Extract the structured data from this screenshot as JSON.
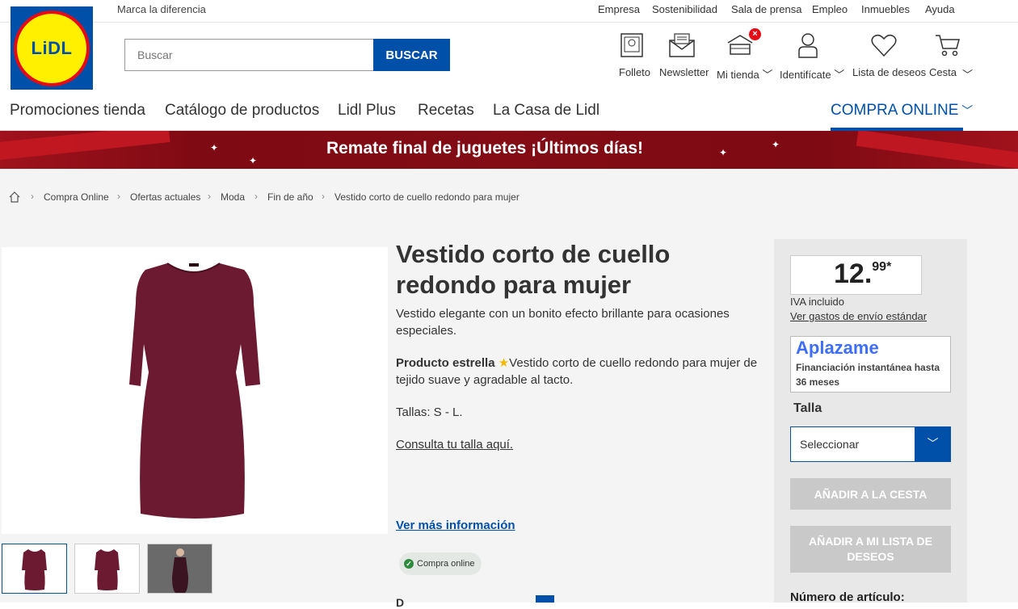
{
  "top_bar": {
    "tagline": "Marca la diferencia",
    "links": [
      "Empresa",
      "Sostenibilidad",
      "Sala de prensa",
      "Empleo",
      "Inmuebles",
      "Ayuda"
    ]
  },
  "logo": {
    "text": "LiDL"
  },
  "search": {
    "placeholder": "Buscar",
    "button": "BUSCAR"
  },
  "header_icons": {
    "folleto": "Folleto",
    "newsletter": "Newsletter",
    "mi_tienda": "Mi tienda",
    "identificate": "Identifícate",
    "lista_deseos": "Lista de deseos",
    "cesta": "Cesta"
  },
  "main_nav": [
    "Promociones tienda",
    "Catálogo de productos",
    "Lidl Plus",
    "Recetas",
    "La Casa de Lidl"
  ],
  "compra_online": "COMPRA ONLINE",
  "banner": {
    "text": "Remate final de juguetes ¡Últimos días!"
  },
  "breadcrumb": [
    "Compra Online",
    "Ofertas actuales",
    "Moda",
    "Fin de año",
    "Vestido corto de cuello redondo para mujer"
  ],
  "product": {
    "title": "Vestido corto de cuello redondo para mujer",
    "subtitle": "Vestido elegante con un bonito efecto brillante para ocasiones especiales.",
    "estrella_label": "Producto estrella",
    "estrella_text": "Vestido corto de cuello redondo para mujer de tejido suave y agradable al tacto.",
    "tallas": "Tallas: S - L.",
    "consulta": "Consulta tu talla aquí.",
    "ver_mas": "Ver más información",
    "online_badge": "Compra online",
    "bottom_peek": "D"
  },
  "sidebar": {
    "price_int": "12.",
    "price_dec": "99*",
    "iva": "IVA incluido",
    "envio": "Ver gastos de envío estándar",
    "aplazame_logo": "Aplazame",
    "aplazame_text": "Financiación instantánea hasta 36 meses",
    "talla_label": "Talla",
    "select_value": "Seleccionar",
    "add_cart": "AÑADIR A LA CESTA",
    "add_wishlist": "AÑADIR A MI LISTA DE DESEOS",
    "art_num": "Número de artículo:"
  },
  "colors": {
    "brand_blue": "#0050aa",
    "brand_red": "#e60a14",
    "brand_yellow": "#fff000",
    "dress": "#6b1a32"
  }
}
